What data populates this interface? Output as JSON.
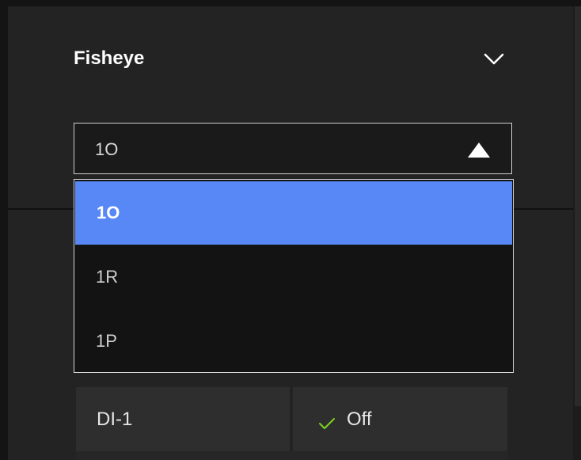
{
  "section": {
    "title": "Fisheye",
    "collapse_icon": "chevron-down-icon"
  },
  "select": {
    "value": "1O",
    "arrow_icon": "triangle-up-icon"
  },
  "dropdown": {
    "options": [
      {
        "label": "1O",
        "selected": true
      },
      {
        "label": "1R",
        "selected": false
      },
      {
        "label": "1P",
        "selected": false
      }
    ]
  },
  "setting_row": {
    "label": "DI-1",
    "value": "Off",
    "value_icon": "checkmark-icon"
  },
  "colors": {
    "accent": "#5788f6",
    "check": "#7ed321",
    "panel": "#232323",
    "text": "#ffffff"
  }
}
